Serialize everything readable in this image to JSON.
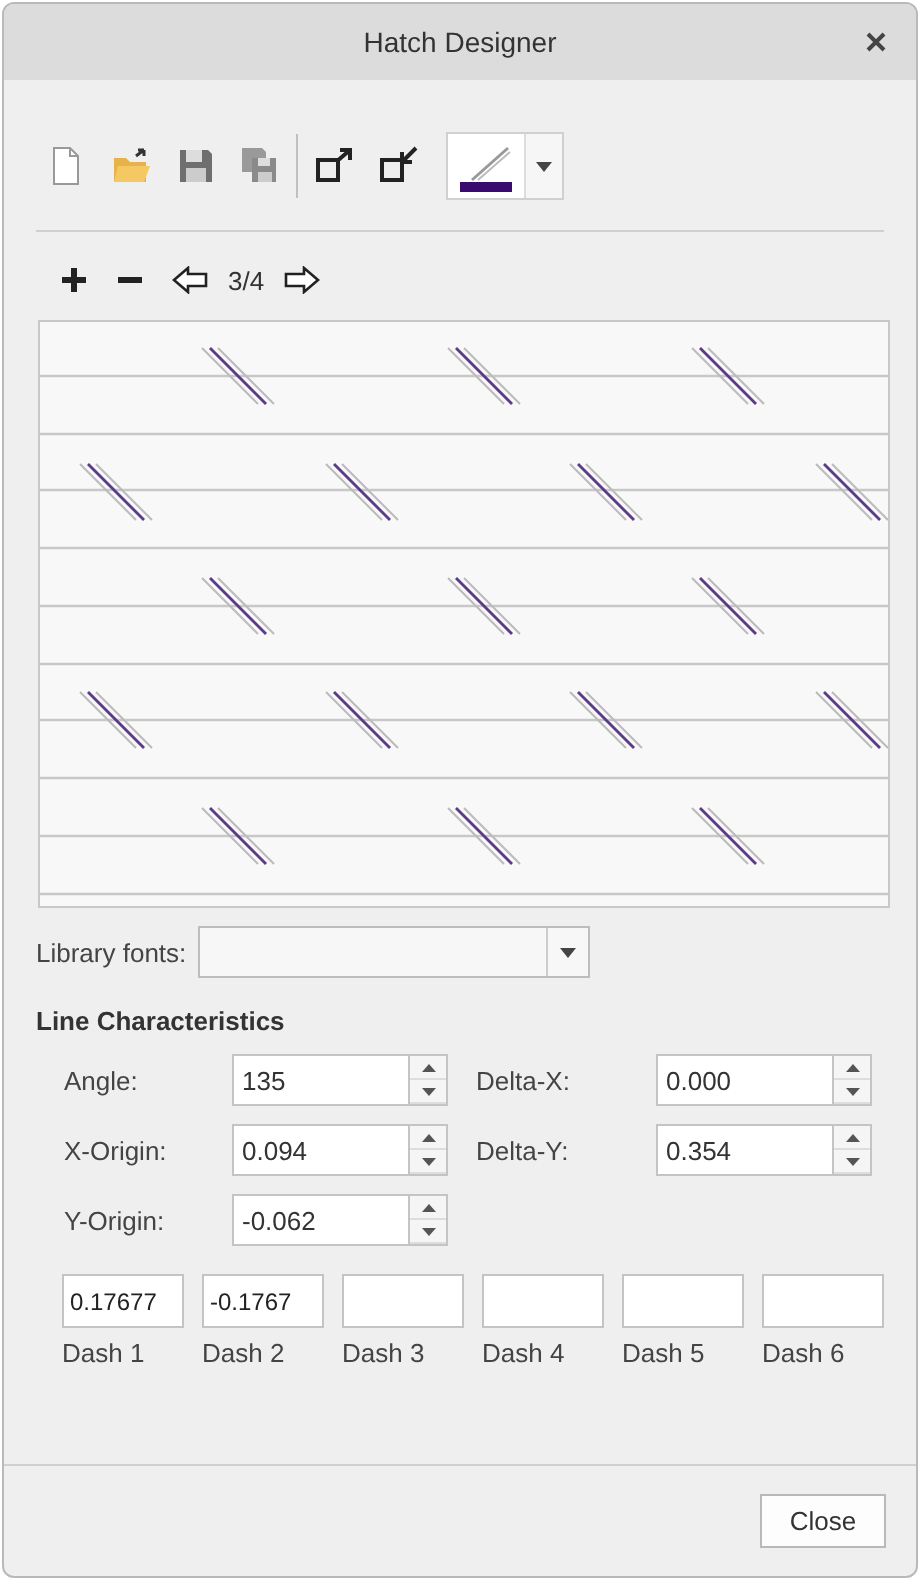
{
  "window": {
    "title": "Hatch Designer"
  },
  "navigation": {
    "page": "3/4"
  },
  "library_fonts": {
    "label": "Library fonts:"
  },
  "line_characteristics": {
    "heading": "Line Characteristics",
    "fields": [
      {
        "label": "Angle:",
        "value": "135"
      },
      {
        "label": "Delta-X:",
        "value": "0.000"
      },
      {
        "label": "X-Origin:",
        "value": "0.094"
      },
      {
        "label": "Delta-Y:",
        "value": "0.354"
      },
      {
        "label": "Y-Origin:",
        "value": "-0.062"
      }
    ]
  },
  "dashes": [
    {
      "label": "Dash 1",
      "value": "0.17677"
    },
    {
      "label": "Dash 2",
      "value": "-0.1767"
    },
    {
      "label": "Dash 3"
    },
    {
      "label": "Dash 4"
    },
    {
      "label": "Dash 5"
    },
    {
      "label": "Dash 6"
    }
  ],
  "buttons": [
    "Close"
  ]
}
